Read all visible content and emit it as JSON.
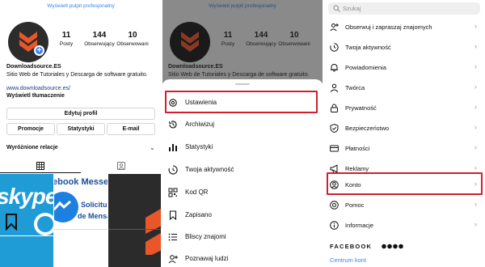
{
  "left": {
    "top_link": "Wyświetl pulpit profesjonalny",
    "stats": [
      {
        "value": "11",
        "label": "Posty"
      },
      {
        "value": "144",
        "label": "Obserwujący"
      },
      {
        "value": "10",
        "label": "Obserwowani"
      }
    ],
    "name": "Downloadsource.ES",
    "bio": "Sitio Web de Tutoriales y Descarga de software gratuito.",
    "website": "www.downloadsource.es/",
    "translate": "Wyświetl tłumaczenie",
    "edit_profile": "Edytuj profil",
    "promo": "Promocje",
    "stats_btn": "Statystyki",
    "email": "E-mail",
    "highlights": "Wyróżnione relacje",
    "thumbs": {
      "skype": "skype",
      "messenger_a": "ebook Messe",
      "messenger_b": "Solicitu",
      "messenger_c": "de Mensa"
    }
  },
  "middle": {
    "ghost_stats": [
      {
        "value": "11",
        "label": "Posty"
      },
      {
        "value": "144",
        "label": "Obserwujący"
      },
      {
        "value": "10",
        "label": "Obserwowani"
      }
    ],
    "ghost_top": "Wyświetl pulpit profesjonalny",
    "ghost_name": "Downloadsource.ES",
    "ghost_bio": "Sitio Web de Tutoriales y Descarga de software gratuito.",
    "menu": [
      {
        "label": "Ustawienia",
        "icon": "settings-icon"
      },
      {
        "label": "Archiwizuj",
        "icon": "archive-icon"
      },
      {
        "label": "Statystyki",
        "icon": "insights-icon"
      },
      {
        "label": "Twoja aktywność",
        "icon": "activity-icon"
      },
      {
        "label": "Kod QR",
        "icon": "qr-code-icon"
      },
      {
        "label": "Zapisano",
        "icon": "bookmark-icon"
      },
      {
        "label": "Bliscy znajomi",
        "icon": "close-friends-icon"
      },
      {
        "label": "Poznawaj ludzi",
        "icon": "discover-people-icon"
      }
    ]
  },
  "right": {
    "search_placeholder": "Szukaj",
    "items": [
      {
        "label": "Obserwuj i zapraszaj znajomych",
        "icon": "add-person-icon"
      },
      {
        "label": "Twoja aktywność",
        "icon": "activity-icon"
      },
      {
        "label": "Powiadomienia",
        "icon": "bell-icon"
      },
      {
        "label": "Twórca",
        "icon": "creator-icon"
      },
      {
        "label": "Prywatność",
        "icon": "lock-icon"
      },
      {
        "label": "Bezpieczeństwo",
        "icon": "shield-icon"
      },
      {
        "label": "Płatności",
        "icon": "card-icon"
      },
      {
        "label": "Reklamy",
        "icon": "megaphone-icon"
      },
      {
        "label": "Konto",
        "icon": "account-icon"
      },
      {
        "label": "Pomoc",
        "icon": "help-icon"
      },
      {
        "label": "Informacje",
        "icon": "info-icon"
      }
    ],
    "facebook": "FACEBOOK",
    "centrum": "Centrum kont"
  },
  "colors": {
    "accent": "#3b82f6",
    "highlight": "#d21f2f",
    "logo": "#e8562a"
  }
}
